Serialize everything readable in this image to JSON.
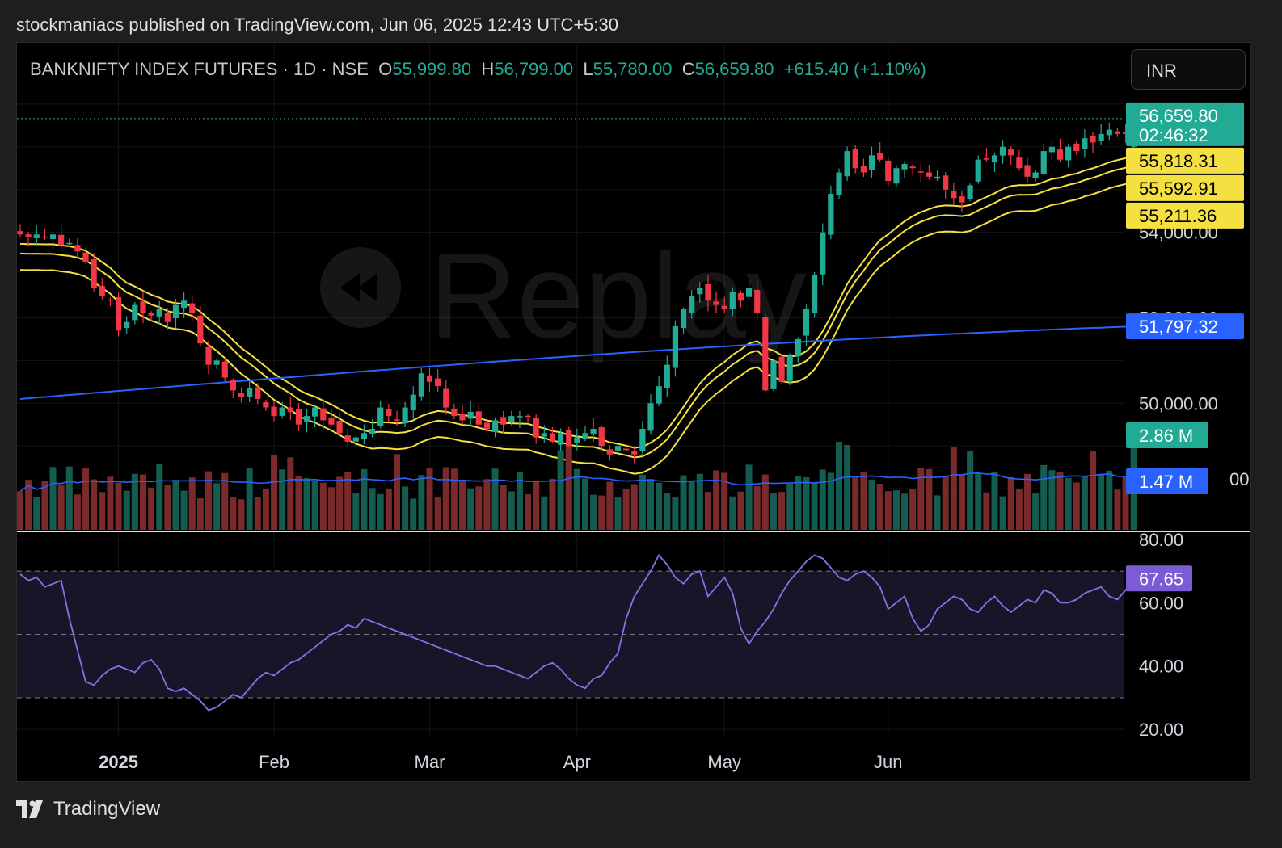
{
  "publisher_line": "stockmaniacs published on TradingView.com, Jun 06, 2025 12:43 UTC+5:30",
  "brand": "TradingView",
  "currency_button": "INR",
  "watermark_text": "Replay",
  "legend": {
    "symbol": "BANKNIFTY INDEX FUTURES · 1D · NSE",
    "o_key": "O",
    "o_val": "55,999.80",
    "h_key": "H",
    "h_val": "56,799.00",
    "l_key": "L",
    "l_val": "55,780.00",
    "c_key": "C",
    "c_val": "56,659.80",
    "change": "+615.40 (+1.10%)"
  },
  "colors": {
    "up": "#22ab94",
    "down": "#f23645",
    "vol_up": "#145c50",
    "vol_down": "#7a2a2a",
    "envelope": "#f5e042",
    "ma": "#2962ff",
    "vol_ma": "#2962ff",
    "rsi": "#8e6ee8",
    "rsi_band": "#181528"
  },
  "chart_data": {
    "type": "candlestick",
    "symbol": "BANKNIFTY INDEX FUTURES",
    "interval": "1D",
    "exchange": "NSE",
    "x_labels": [
      "2025",
      "Feb",
      "Mar",
      "Apr",
      "May",
      "Jun"
    ],
    "x_label_index": [
      12,
      31,
      50,
      68,
      86,
      106
    ],
    "price_axis_ticks": [
      "54,000.00",
      "52,000.00",
      "50,000.00"
    ],
    "price_ylim": [
      47000,
      57300
    ],
    "price_badges": [
      {
        "label": "56,659.80",
        "sub": "02:46:32",
        "value": 56659.8,
        "color": "#22ab94",
        "text_color": "#ffffff"
      },
      {
        "label": "55,818.31",
        "value": 55818.31,
        "color": "#f5e042",
        "text_color": "#000000"
      },
      {
        "label": "55,592.91",
        "value": 55592.91,
        "color": "#f5e042",
        "text_color": "#000000"
      },
      {
        "label": "55,211.36",
        "value": 55211.36,
        "color": "#f5e042",
        "text_color": "#000000"
      },
      {
        "label": "51,797.32",
        "value": 51797.32,
        "color": "#2962ff",
        "text_color": "#ffffff"
      }
    ],
    "volume_badges": [
      {
        "label": "2.86 M",
        "color": "#22ab94"
      },
      {
        "label": "1.47 M",
        "color": "#2962ff"
      }
    ],
    "volume_axis_partial_label": "00",
    "rsi_axis_ticks": [
      "80.00",
      "60.00",
      "40.00",
      "20.00"
    ],
    "rsi_levels": [
      70,
      50,
      30
    ],
    "rsi_ylim": [
      18,
      82
    ],
    "rsi_badge": {
      "label": "67.65",
      "value": 67.65,
      "color": "#7b5bd6"
    },
    "close": [
      53950,
      53900,
      53950,
      53900,
      53950,
      53700,
      53750,
      53550,
      53300,
      52700,
      52500,
      52400,
      51700,
      51900,
      52300,
      52100,
      52050,
      52200,
      51900,
      52300,
      52400,
      52100,
      51400,
      50900,
      51000,
      50600,
      50300,
      50150,
      50350,
      50100,
      49900,
      49700,
      49900,
      49800,
      49500,
      49700,
      49900,
      49600,
      49500,
      49300,
      49100,
      49200,
      49300,
      49400,
      49900,
      49700,
      49600,
      49900,
      50200,
      50700,
      50500,
      50400,
      49900,
      49700,
      49600,
      49800,
      49500,
      49400,
      49600,
      49500,
      49700,
      49700,
      49700,
      49200,
      49300,
      49100,
      49300,
      49000,
      49200,
      49300,
      49400,
      49000,
      48800,
      49000,
      48900,
      48800,
      49400,
      50000,
      50400,
      50900,
      51800,
      52200,
      52500,
      52700,
      52400,
      52300,
      52200,
      52600,
      52400,
      52700,
      52100,
      50300,
      51000,
      50500,
      51100,
      51500,
      52200,
      53000,
      54000,
      54900,
      55400,
      55900,
      55500,
      55400,
      55800,
      55700,
      55200,
      55500,
      55600,
      55500,
      55400,
      55300,
      55300,
      55000,
      54800,
      54700,
      55100,
      55700,
      55700,
      55800,
      56000,
      55800,
      55500,
      55300,
      55400,
      55900,
      56000,
      55700,
      56000,
      55900,
      56200,
      56100,
      56300,
      56400,
      56300,
      56300,
      56659.8
    ],
    "ma200_start": 50100,
    "ma200_end": 51797.32,
    "envelope_ref_end": [
      55818.31,
      55592.91,
      55211.36
    ],
    "volume_ma_end": 1.47,
    "volume_last": 2.86,
    "rsi": [
      69,
      67,
      68,
      65,
      66,
      67,
      55,
      45,
      35,
      34,
      37,
      39,
      40,
      39,
      38,
      41,
      42,
      39,
      33,
      32,
      33,
      31,
      29,
      26,
      27,
      29,
      31,
      30,
      33,
      36,
      38,
      37,
      39,
      41,
      42,
      44,
      46,
      48,
      50,
      51,
      53,
      52,
      55,
      54,
      53,
      52,
      51,
      50,
      49,
      48,
      47,
      46,
      45,
      44,
      43,
      42,
      41,
      40,
      40,
      39,
      38,
      37,
      36,
      38,
      40,
      41,
      39,
      36,
      34,
      33,
      36,
      37,
      41,
      44,
      55,
      62,
      66,
      70,
      75,
      72,
      68,
      66,
      69,
      70,
      62,
      65,
      68,
      63,
      52,
      47,
      51,
      54,
      58,
      63,
      67,
      70,
      73,
      75,
      74,
      71,
      68,
      67,
      69,
      70,
      68,
      65,
      58,
      60,
      62,
      55,
      51,
      53,
      58,
      60,
      62,
      61,
      58,
      57,
      60,
      62,
      59,
      57,
      59,
      61,
      60,
      64,
      63,
      60,
      60,
      61,
      63,
      64,
      65,
      62,
      61,
      64,
      67.65
    ]
  }
}
